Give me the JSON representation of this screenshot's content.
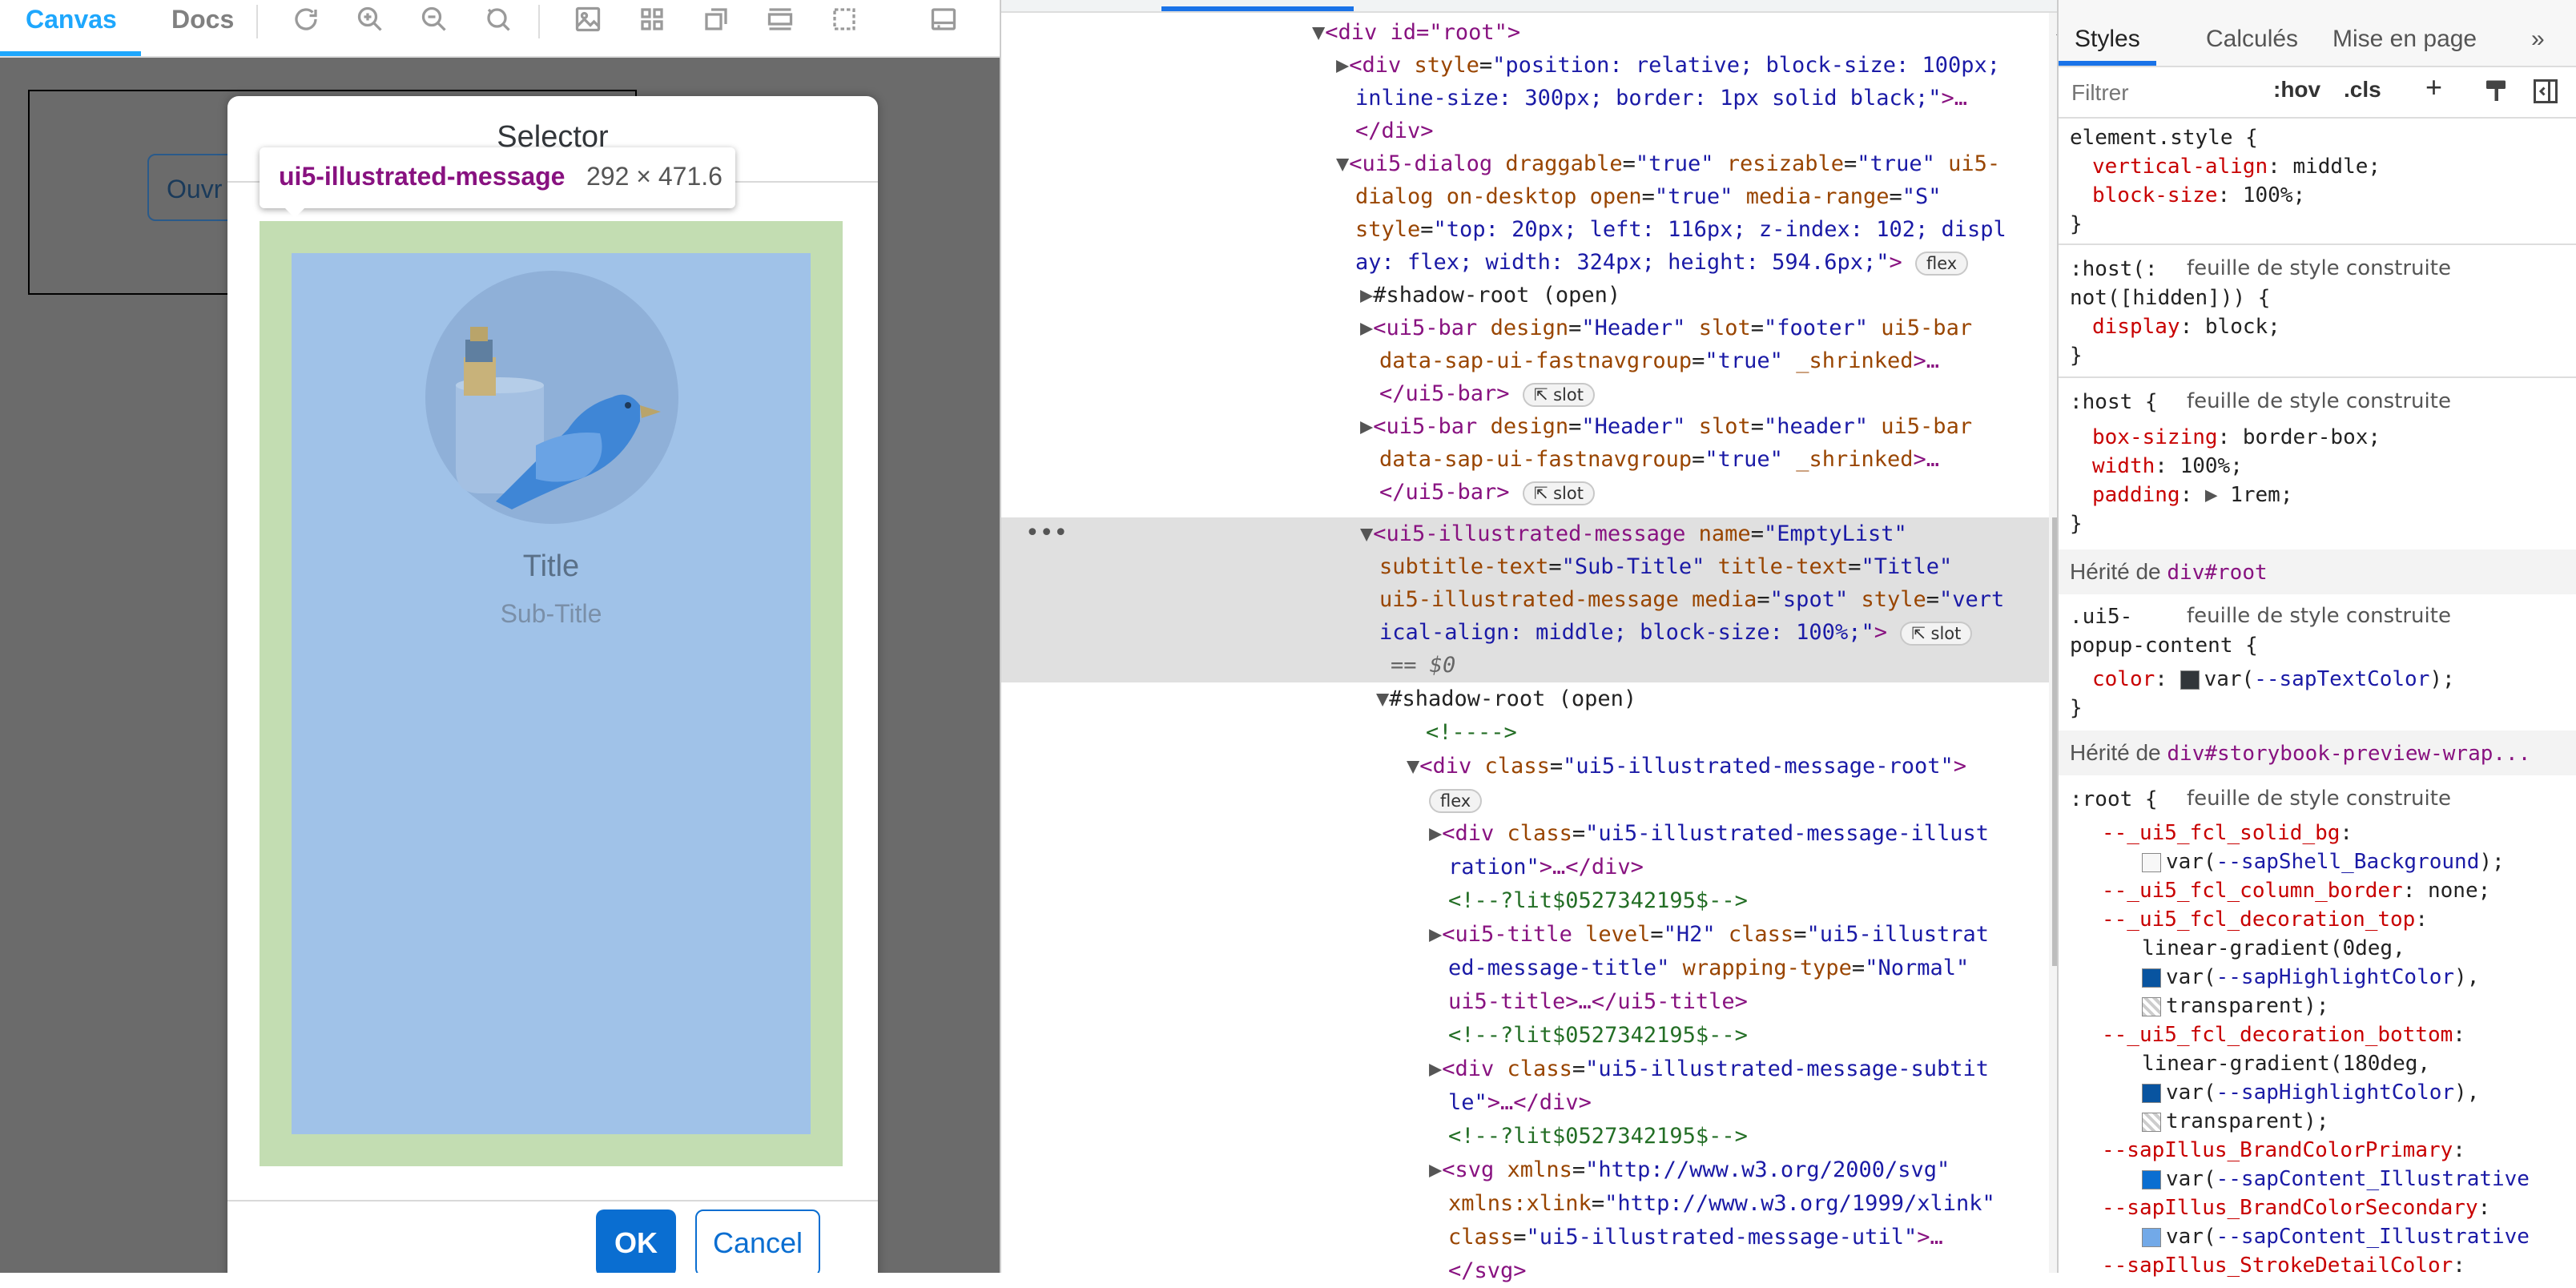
{
  "left": {
    "tabs": {
      "canvas": "Canvas",
      "docs": "Docs"
    },
    "toolbar_icons": [
      "refresh-icon",
      "zoom-in-icon",
      "zoom-out-icon",
      "zoom-reset-icon",
      "image-icon",
      "grid-icon",
      "background-icon",
      "measure-icon",
      "outline-icon",
      "panel-icon"
    ],
    "ouvrir_label": "Ouvr",
    "dialog": {
      "title": "Selector",
      "ok": "OK",
      "cancel": "Cancel"
    },
    "illustrated": {
      "title": "Title",
      "subtitle": "Sub-Title"
    },
    "tooltip": {
      "name": "ui5-illustrated-message",
      "dims": "292 × 471.6"
    }
  },
  "elements": {
    "line1": {
      "t1": "<div id=\"root\">"
    },
    "line2": {
      "t1": "<div ",
      "a1": "style",
      "v1": "\"position: relative; block-size: 100px;"
    },
    "line3": {
      "v1": "inline-size: 300px; border: 1px solid black;\"",
      "t1": ">…"
    },
    "line4": {
      "t1": "</div>"
    },
    "line5": {
      "t1": "<ui5-dialog ",
      "a1": "draggable",
      "v1": "\"true\"",
      "a2": " resizable",
      "v2": "\"true\"",
      "a3": " ui5-"
    },
    "line6": {
      "a1": "dialog on-desktop open",
      "v1": "\"true\"",
      "a2": " media-range",
      "v2": "\"S\""
    },
    "line7": {
      "a1": "style",
      "v1": "\"top: 20px; left: 116px; z-index: 102; displ"
    },
    "line8": {
      "v1": "ay: flex; width: 324px; height: 594.6px;\"",
      "t1": ">",
      "badge": "flex"
    },
    "line9": {
      "t1": "#shadow-root (open)"
    },
    "line10": {
      "t1": "<ui5-bar ",
      "a1": "design",
      "v1": "\"Header\"",
      "a2": " slot",
      "v2": "\"footer\"",
      "a3": " ui5-bar"
    },
    "line11": {
      "a1": "data-sap-ui-fastnavgroup",
      "v1": "\"true\"",
      "a2": " _shrinked",
      "t1": ">…"
    },
    "line12": {
      "t1": "</ui5-bar>",
      "badge": "slot"
    },
    "line13": {
      "t1": "<ui5-bar ",
      "a1": "design",
      "v1": "\"Header\"",
      "a2": " slot",
      "v2": "\"header\"",
      "a3": " ui5-bar"
    },
    "line14": {
      "a1": "data-sap-ui-fastnavgroup",
      "v1": "\"true\"",
      "a2": " _shrinked",
      "t1": ">…"
    },
    "line15": {
      "t1": "</ui5-bar>",
      "badge": "slot"
    },
    "line16": {
      "t1": "<ui5-illustrated-message ",
      "a1": "name",
      "v1": "\"EmptyList\""
    },
    "line17": {
      "a1": "subtitle-text",
      "v1": "\"Sub-Title\"",
      "a2": " title-text",
      "v2": "\"Title\""
    },
    "line18": {
      "a1": "ui5-illustrated-message media",
      "v1": "\"spot\"",
      "a2": " style",
      "v2": "\"vert"
    },
    "line19": {
      "v1": "ical-align: middle; block-size: 100%;\"",
      "t1": ">",
      "badge": "slot"
    },
    "line20": {
      "t1": "== $0"
    },
    "line21": {
      "t1": "#shadow-root (open)"
    },
    "line22": {
      "t1": "<!---->"
    },
    "line23": {
      "t1": "<div ",
      "a1": "class",
      "v1": "\"ui5-illustrated-message-root\"",
      "t2": ">"
    },
    "line24": {
      "badge": "flex"
    },
    "line25": {
      "t1": "<div ",
      "a1": "class",
      "v1": "\"ui5-illustrated-message-illust"
    },
    "line26": {
      "v1": "ration\"",
      "t1": ">…</div>"
    },
    "line27": {
      "t1": "<!--?lit$0527342195$-->"
    },
    "line28": {
      "t1": "<ui5-title ",
      "a1": "level",
      "v1": "\"H2\"",
      "a2": " class",
      "v2": "\"ui5-illustrat"
    },
    "line29": {
      "v1": "ed-message-title\"",
      "a1": " wrapping-type",
      "v2": "\"Normal\""
    },
    "line30": {
      "t1": "ui5-title>…</ui5-title>"
    },
    "line31": {
      "t1": "<!--?lit$0527342195$-->"
    },
    "line32": {
      "t1": "<div ",
      "a1": "class",
      "v1": "\"ui5-illustrated-message-subtit"
    },
    "line33": {
      "v1": "le\"",
      "t1": ">…</div>"
    },
    "line34": {
      "t1": "<!--?lit$0527342195$-->"
    },
    "line35": {
      "t1": "<svg ",
      "a1": "xmlns",
      "v1": "\"http://www.w3.org/2000/svg\""
    },
    "line36": {
      "a1": "xmlns:xlink",
      "v1": "\"http://www.w3.org/1999/xlink\""
    },
    "line37": {
      "a1": "class",
      "v1": "\"ui5-illustrated-message-util\"",
      "t1": ">…"
    },
    "line38": {
      "t1": "</svg>"
    }
  },
  "styles": {
    "tabs": {
      "styles": "Styles",
      "computed": "Calculés",
      "layout": "Mise en page",
      "more": "»"
    },
    "filter_placeholder": "Filtrer",
    "hov": ":hov",
    "cls": ".cls",
    "plus": "+",
    "src": "feuille de style construite",
    "r1": {
      "sel": "element.style {",
      "p1": "vertical-align",
      "v1": "middle;",
      "p2": "block-size",
      "v2": "100%;",
      "close": "}"
    },
    "r2": {
      "sel1": ":host(:",
      "sel2": "not([hidden])) {",
      "p1": "display",
      "v1": "block;",
      "close": "}"
    },
    "r3": {
      "sel": ":host {",
      "p1": "box-sizing",
      "v1": "border-box;",
      "p2": "width",
      "v2": "100%;",
      "p3": "padding",
      "v3": "1rem;",
      "close": "}"
    },
    "inh1": {
      "label": "Hérité de ",
      "sel": "div#root"
    },
    "r4": {
      "sel1": ".ui5-",
      "sel2": "popup-content {",
      "p1": "color",
      "v1a": "var(",
      "v1b": "--sapTextColor",
      "v1c": ");",
      "close": "}"
    },
    "inh2": {
      "label": "Hérité de ",
      "sel": "div#storybook-preview-wrap..."
    },
    "r5": {
      "sel": ":root {",
      "p1": "--_ui5_fcl_solid_bg",
      "v1a": "var(",
      "v1b": "--sapShell_Background",
      "v1c": ");",
      "p2": "--_ui5_fcl_column_border",
      "v2": "none;",
      "p3": "--_ui5_fcl_decoration_top",
      "v3a": "linear-gradient(0deg,",
      "v3b1": "var(",
      "v3b2": "--sapHighlightColor",
      "v3b3": "),",
      "v3c": "transparent);",
      "p4": "--_ui5_fcl_decoration_bottom",
      "v4a": "linear-gradient(180deg,",
      "v4b1": "var(",
      "v4b2": "--sapHighlightColor",
      "v4b3": "),",
      "v4c": "transparent);",
      "p5": "--sapIllus_BrandColorPrimary",
      "v5a": "var(",
      "v5b": "--sapContent_Illustrative",
      "p6": "--sapIllus_BrandColorSecondary",
      "v6a": "var(",
      "v6b": "--sapContent_Illustrative",
      "p7": "--sapIllus_StrokeDetailColor"
    }
  },
  "colors": {
    "accent": "#1ea7fd",
    "ok": "#0a6ed1",
    "padding_overlay": "#c3ddb2",
    "content_overlay": "#a0c2e8",
    "highlight": "#0854a0"
  }
}
